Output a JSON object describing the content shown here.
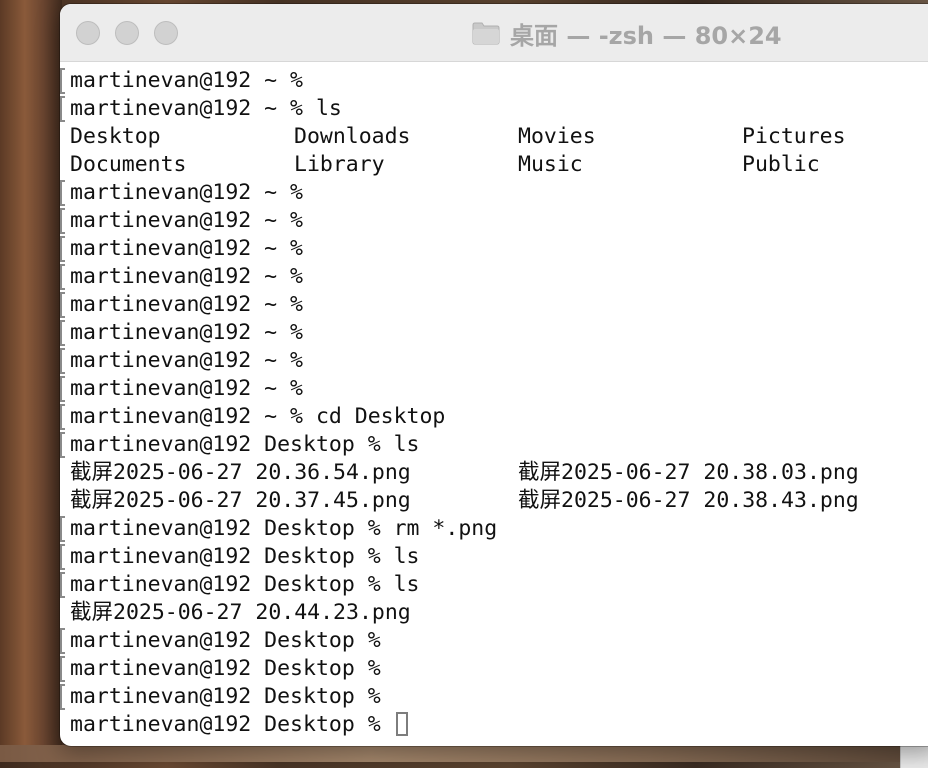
{
  "window": {
    "title": "桌面 — -zsh — 80×24"
  },
  "terminal": {
    "lines": [
      "martinevan@192 ~ %",
      "martinevan@192 ~ % ls",
      null,
      null,
      "martinevan@192 ~ %",
      "martinevan@192 ~ %",
      "martinevan@192 ~ %",
      "martinevan@192 ~ %",
      "martinevan@192 ~ %",
      "martinevan@192 ~ %",
      "martinevan@192 ~ %",
      "martinevan@192 ~ %",
      "martinevan@192 ~ % cd Desktop",
      "martinevan@192 Desktop % ls",
      null,
      null,
      "martinevan@192 Desktop % rm *.png",
      "martinevan@192 Desktop % ls",
      "martinevan@192 Desktop % ls",
      "截屏2025-06-27 20.44.23.png",
      "martinevan@192 Desktop %",
      "martinevan@192 Desktop %",
      "martinevan@192 Desktop %",
      "martinevan@192 Desktop %"
    ],
    "ls_home": [
      [
        "Desktop",
        "Downloads",
        "Movies",
        "Pictures"
      ],
      [
        "Documents",
        "Library",
        "Music",
        "Public"
      ]
    ],
    "ls_desktop": [
      [
        "截屏2025-06-27 20.36.54.png",
        "截屏2025-06-27 20.38.03.png"
      ],
      [
        "截屏2025-06-27 20.37.45.png",
        "截屏2025-06-27 20.38.43.png"
      ]
    ]
  }
}
